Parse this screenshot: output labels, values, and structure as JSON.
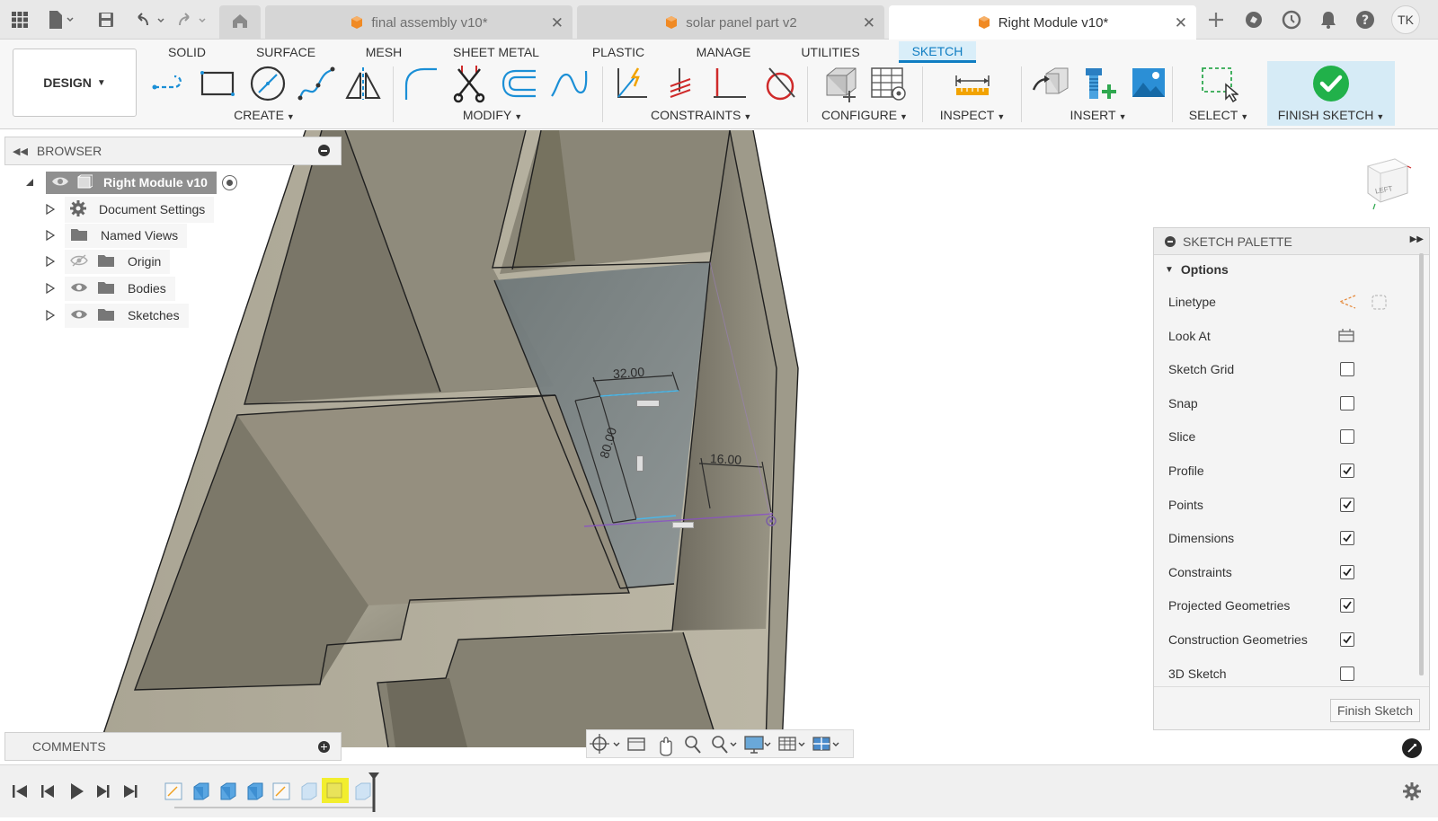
{
  "titlebar": {
    "tabs": [
      {
        "label": "final assembly v10*",
        "active": false
      },
      {
        "label": "solar panel part v2",
        "active": false
      },
      {
        "label": "Right Module v10*",
        "active": true
      }
    ],
    "user_initials": "TK"
  },
  "ribbon": {
    "tabs": [
      "SOLID",
      "SURFACE",
      "MESH",
      "SHEET METAL",
      "PLASTIC",
      "MANAGE",
      "UTILITIES",
      "SKETCH"
    ],
    "active_tab": "SKETCH",
    "workspace": "DESIGN",
    "groups": {
      "create": "CREATE",
      "modify": "MODIFY",
      "constraints": "CONSTRAINTS",
      "configure": "CONFIGURE",
      "inspect": "INSPECT",
      "insert": "INSERT",
      "select": "SELECT",
      "finish": "FINISH SKETCH"
    },
    "accent": "#0f7dc2"
  },
  "browser": {
    "title": "BROWSER",
    "root": "Right Module v10",
    "items": [
      "Document Settings",
      "Named Views",
      "Origin",
      "Bodies",
      "Sketches"
    ]
  },
  "comments": {
    "title": "COMMENTS"
  },
  "viewport": {
    "dimensions": [
      "32.00",
      "80.00",
      "16.00"
    ],
    "viewcube_face": "LEFT"
  },
  "palette": {
    "title": "SKETCH PALETTE",
    "section": "Options",
    "rows": [
      {
        "label": "Linetype",
        "kind": "icons"
      },
      {
        "label": "Look At",
        "kind": "button"
      },
      {
        "label": "Sketch Grid",
        "kind": "check",
        "checked": false
      },
      {
        "label": "Snap",
        "kind": "check",
        "checked": false
      },
      {
        "label": "Slice",
        "kind": "check",
        "checked": false
      },
      {
        "label": "Profile",
        "kind": "check",
        "checked": true
      },
      {
        "label": "Points",
        "kind": "check",
        "checked": true
      },
      {
        "label": "Dimensions",
        "kind": "check",
        "checked": true
      },
      {
        "label": "Constraints",
        "kind": "check",
        "checked": true
      },
      {
        "label": "Projected Geometries",
        "kind": "check",
        "checked": true
      },
      {
        "label": "Construction Geometries",
        "kind": "check",
        "checked": true
      },
      {
        "label": "3D Sketch",
        "kind": "check",
        "checked": false
      }
    ],
    "finish_button": "Finish Sketch"
  }
}
